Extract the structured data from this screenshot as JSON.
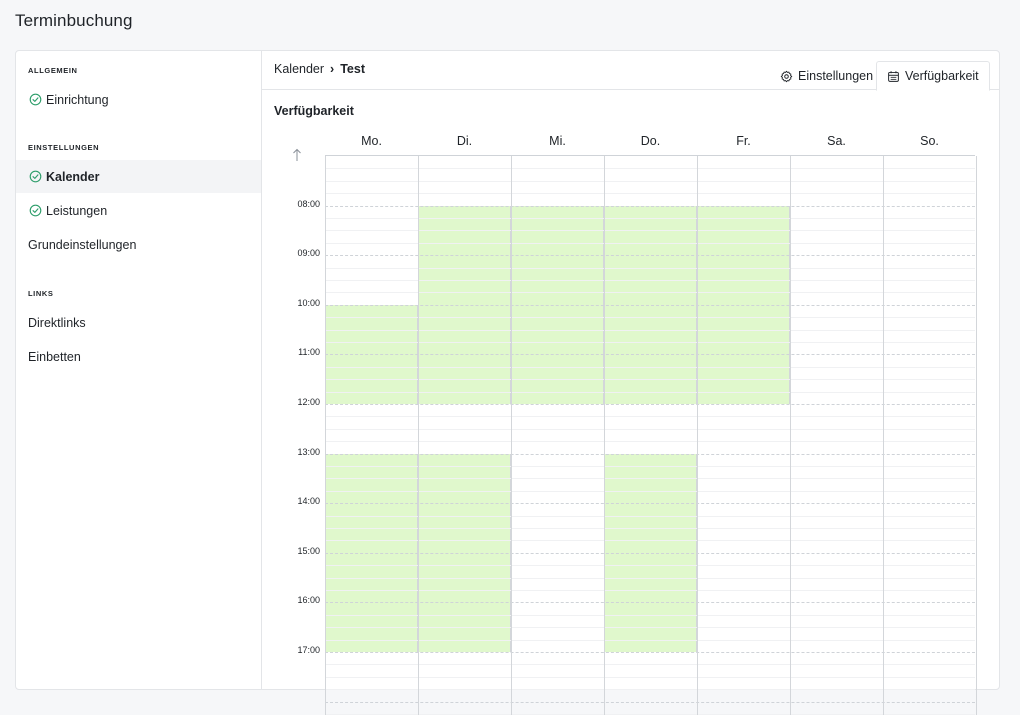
{
  "app": {
    "title": "Terminbuchung"
  },
  "sidebar": {
    "sections": [
      {
        "header": "ALLGEMEIN",
        "items": [
          {
            "label": "Einrichtung",
            "icon": "check-circle-icon",
            "active": false
          }
        ]
      },
      {
        "header": "EINSTELLUNGEN",
        "items": [
          {
            "label": "Kalender",
            "icon": "check-circle-icon",
            "active": true
          },
          {
            "label": "Leistungen",
            "icon": "check-circle-icon",
            "active": false
          },
          {
            "label": "Grundeinstellungen",
            "icon": "",
            "active": false
          }
        ]
      },
      {
        "header": "LINKS",
        "items": [
          {
            "label": "Direktlinks",
            "icon": "",
            "active": false
          },
          {
            "label": "Einbetten",
            "icon": "",
            "active": false
          }
        ]
      }
    ]
  },
  "breadcrumb": {
    "parent": "Kalender",
    "separator": "›",
    "current": "Test"
  },
  "tabs": [
    {
      "label": "Einstellungen",
      "icon": "gear-icon",
      "active": false
    },
    {
      "label": "Verfügbarkeit",
      "icon": "calendar-icon",
      "active": true
    }
  ],
  "availability": {
    "title": "Verfügbarkeit",
    "days": [
      "Mo.",
      "Di.",
      "Mi.",
      "Do.",
      "Fr.",
      "Sa.",
      "So."
    ],
    "time_labels": [
      "08:00",
      "09:00",
      "10:00",
      "11:00",
      "12:00",
      "13:00",
      "14:00",
      "15:00",
      "16:00",
      "17:00"
    ],
    "grid_start_hour": 7,
    "slots": [
      {
        "day": 0,
        "from": 10,
        "to": 12
      },
      {
        "day": 0,
        "from": 13,
        "to": 17
      },
      {
        "day": 1,
        "from": 8,
        "to": 12
      },
      {
        "day": 1,
        "from": 13,
        "to": 17
      },
      {
        "day": 2,
        "from": 8,
        "to": 12
      },
      {
        "day": 3,
        "from": 8,
        "to": 12
      },
      {
        "day": 3,
        "from": 13,
        "to": 17
      },
      {
        "day": 4,
        "from": 8,
        "to": 12
      }
    ],
    "available_color": "#e0f8cc"
  },
  "colors": {
    "check": "#2e9e6b",
    "border": "#e3e5e8"
  }
}
